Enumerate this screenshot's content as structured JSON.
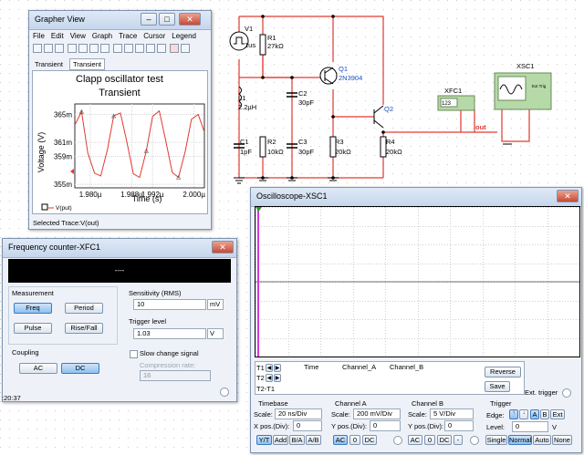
{
  "schematic": {
    "v1": {
      "name": "V1",
      "value": "1us"
    },
    "r1": {
      "name": "R1",
      "value": "27kΩ"
    },
    "q1": {
      "name": "Q1",
      "value": "2N3904"
    },
    "q2": {
      "name": "Q2"
    },
    "l1": {
      "name": "L1",
      "value": "2.2µH"
    },
    "c2": {
      "name": "C2",
      "value": "30pF"
    },
    "c1": {
      "name": "C1",
      "value": "1pF"
    },
    "r2": {
      "name": "R2",
      "value": "10kΩ"
    },
    "c3": {
      "name": "C3",
      "value": "30pF"
    },
    "r3": {
      "name": "R3",
      "value": "20kΩ"
    },
    "r4": {
      "name": "R4",
      "value": "20kΩ"
    },
    "xfc1": {
      "name": "XFC1",
      "display": "123"
    },
    "xsc1": {
      "name": "XSC1",
      "ext_trig": "Ext Trig"
    },
    "out_label": "out"
  },
  "grapher": {
    "title": "Grapher View",
    "menu": [
      "File",
      "Edit",
      "View",
      "Graph",
      "Trace",
      "Cursor",
      "Legend"
    ],
    "tabs": [
      "Transient",
      "Transient"
    ],
    "chart_title": "Clapp oscillator test",
    "chart_subtitle": "Transient",
    "ylabel": "Voltage (V)",
    "xlabel": "Time (s)",
    "yticks": [
      "365m",
      "361m",
      "359m",
      "355m"
    ],
    "xticks": [
      "1.980µ",
      "1.988µ",
      "1.992µ",
      "2.000µ"
    ],
    "legend": "V(put)",
    "status": "Selected Trace:V(out)",
    "trace_color": "#e03a2f"
  },
  "chart_data": {
    "type": "line",
    "title": "Clapp oscillator test",
    "subtitle": "Transient",
    "xlabel": "Time (s)",
    "ylabel": "Voltage (V)",
    "xlim": [
      1.977,
      2.002
    ],
    "ylim": [
      0.3545,
      0.3665
    ],
    "series": [
      {
        "name": "V(put)",
        "x_unit": "µs",
        "x": [
          1.977,
          1.9783,
          1.9795,
          1.9808,
          1.982,
          1.9833,
          1.9845,
          1.9858,
          1.987,
          1.9883,
          1.9895,
          1.9908,
          1.992,
          1.9933,
          1.9945,
          1.9958,
          1.997,
          1.9983,
          1.9995,
          2.0008,
          2.002
        ],
        "y": [
          0.3635,
          0.3654,
          0.3595,
          0.3566,
          0.3562,
          0.36,
          0.3648,
          0.3652,
          0.3612,
          0.3565,
          0.356,
          0.3598,
          0.3647,
          0.3655,
          0.3614,
          0.3567,
          0.356,
          0.3597,
          0.3643,
          0.365,
          0.3625
        ]
      }
    ]
  },
  "freq_counter": {
    "title": "Frequency counter-XFC1",
    "display": "----",
    "measurement_label": "Measurement",
    "buttons": [
      "Freq",
      "Period",
      "Pulse",
      "Rise/Fall"
    ],
    "coupling_label": "Coupling",
    "coupling": [
      "AC",
      "DC"
    ],
    "sensitivity_label": "Sensitivity (RMS)",
    "sensitivity_value": "10",
    "sensitivity_unit": "mV",
    "trigger_label": "Trigger level",
    "trigger_value": "1.03",
    "trigger_unit": "V",
    "slow_change": "Slow change signal",
    "compression_label": "Compression rate:",
    "compression_value": "16"
  },
  "oscilloscope": {
    "title": "Oscilloscope-XSC1",
    "cursor_rows": [
      "T1",
      "T2",
      "T2-T1"
    ],
    "col_headers": [
      "Time",
      "Channel_A",
      "Channel_B"
    ],
    "reverse": "Reverse",
    "save": "Save",
    "ext_trigger": "Ext. trigger",
    "timebase": {
      "label": "Timebase",
      "scale_label": "Scale:",
      "scale": "20 ns/Div",
      "pos_label": "X pos.(Div):",
      "pos": "0",
      "modes": [
        "Y/T",
        "Add",
        "B/A",
        "A/B"
      ]
    },
    "channel_a": {
      "label": "Channel A",
      "scale_label": "Scale:",
      "scale": "200 mV/Div",
      "pos_label": "Y pos.(Div):",
      "pos": "0",
      "modes": [
        "AC",
        "0",
        "DC"
      ]
    },
    "channel_b": {
      "label": "Channel B",
      "scale_label": "Scale:",
      "scale": "5  V/Div",
      "pos_label": "Y pos.(Div):",
      "pos": "0",
      "modes": [
        "AC",
        "0",
        "DC",
        "-"
      ]
    },
    "trigger": {
      "label": "Trigger",
      "edge_label": "Edge:",
      "sources": [
        "A",
        "B",
        "Ext"
      ],
      "level_label": "Level:",
      "level": "0",
      "level_unit": "V",
      "modes": [
        "Single",
        "Normal",
        "Auto",
        "None"
      ]
    }
  },
  "taskbar_time": ":20:37"
}
